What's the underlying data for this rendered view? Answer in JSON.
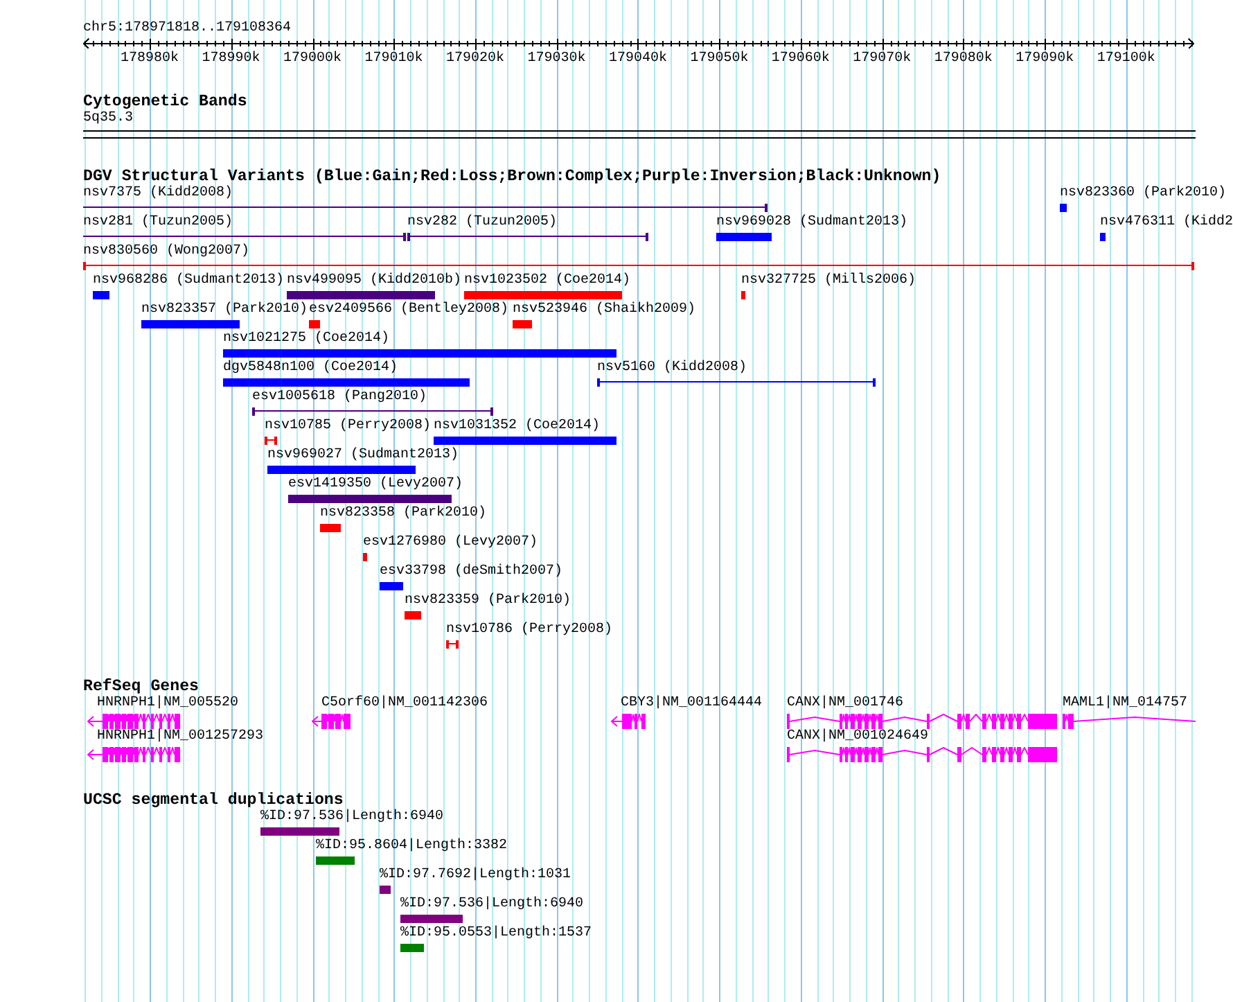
{
  "ruler": {
    "location": "chr5:178971818..179108364",
    "ticks": [
      "178980k",
      "178990k",
      "179000k",
      "179010k",
      "179020k",
      "179030k",
      "179040k",
      "179050k",
      "179060k",
      "179070k",
      "179080k",
      "179090k",
      "179100k"
    ]
  },
  "cytogenetic_bands": {
    "title": "Cytogenetic Bands",
    "band": "5q35.3"
  },
  "dgv_structural_variants": {
    "title": "DGV Structural Variants (Blue:Gain;Red:Loss;Brown:Complex;Purple:Inversion;Black:Unknown)",
    "rows": [
      {
        "features": [
          {
            "label": "nsv7375 (Kidd2008)",
            "kind": "span",
            "color": "#4b0082"
          },
          {
            "label": "nsv823360 (Park2010)",
            "kind": "bar",
            "color": "#0000ff"
          }
        ]
      },
      {
        "features": [
          {
            "label": "nsv281 (Tuzun2005)",
            "kind": "span",
            "color": "#4b0082"
          },
          {
            "label": "nsv282 (Tuzun2005)",
            "kind": "span",
            "color": "#4b0082"
          },
          {
            "label": "nsv969028 (Sudmant2013)",
            "kind": "bar",
            "color": "#0000ff"
          },
          {
            "label": "nsv476311 (Kidd2",
            "kind": "bar",
            "color": "#0000ff"
          }
        ]
      },
      {
        "features": [
          {
            "label": "nsv830560 (Wong2007)",
            "kind": "span",
            "color": "#ff0000"
          }
        ]
      },
      {
        "features": [
          {
            "label": "nsv968286 (Sudmant2013)",
            "kind": "bar",
            "color": "#0000ff"
          },
          {
            "label": "nsv499095 (Kidd2010b)",
            "kind": "bar",
            "color": "#4b0082"
          },
          {
            "label": "nsv1023502 (Coe2014)",
            "kind": "bar",
            "color": "#ff0000"
          },
          {
            "label": "nsv327725 (Mills2006)",
            "kind": "bar",
            "color": "#ff0000"
          }
        ]
      },
      {
        "features": [
          {
            "label": "nsv823357 (Park2010)",
            "kind": "bar",
            "color": "#0000ff"
          },
          {
            "label": "esv2409566 (Bentley2008)",
            "kind": "bar",
            "color": "#ff0000"
          },
          {
            "label": "nsv523946 (Shaikh2009)",
            "kind": "bar",
            "color": "#ff0000"
          }
        ]
      },
      {
        "features": [
          {
            "label": "nsv1021275 (Coe2014)",
            "kind": "bar",
            "color": "#0000ff"
          }
        ]
      },
      {
        "features": [
          {
            "label": "dgv5848n100 (Coe2014)",
            "kind": "bar",
            "color": "#0000ff"
          },
          {
            "label": "nsv5160 (Kidd2008)",
            "kind": "span",
            "color": "#0000ff"
          }
        ]
      },
      {
        "features": [
          {
            "label": "esv1005618 (Pang2010)",
            "kind": "span",
            "color": "#4b0082"
          }
        ]
      },
      {
        "features": [
          {
            "label": "nsv10785 (Perry2008)",
            "kind": "span",
            "color": "#ff0000"
          },
          {
            "label": "nsv1031352 (Coe2014)",
            "kind": "bar",
            "color": "#0000ff"
          }
        ]
      },
      {
        "features": [
          {
            "label": "nsv969027 (Sudmant2013)",
            "kind": "bar",
            "color": "#0000ff"
          }
        ]
      },
      {
        "features": [
          {
            "label": "esv1419350 (Levy2007)",
            "kind": "bar",
            "color": "#4b0082"
          }
        ]
      },
      {
        "features": [
          {
            "label": "nsv823358 (Park2010)",
            "kind": "bar",
            "color": "#ff0000"
          }
        ]
      },
      {
        "features": [
          {
            "label": "esv1276980 (Levy2007)",
            "kind": "bar",
            "color": "#ff0000"
          }
        ]
      },
      {
        "features": [
          {
            "label": "esv33798 (deSmith2007)",
            "kind": "bar",
            "color": "#0000ff"
          }
        ]
      },
      {
        "features": [
          {
            "label": "nsv823359 (Park2010)",
            "kind": "bar",
            "color": "#ff0000"
          }
        ]
      },
      {
        "features": [
          {
            "label": "nsv10786 (Perry2008)",
            "kind": "span",
            "color": "#ff0000"
          }
        ]
      }
    ]
  },
  "refseq_genes": {
    "title": "RefSeq Genes",
    "rows": [
      {
        "genes": [
          {
            "label": "HNRNPH1|NM_005520"
          },
          {
            "label": "C5orf60|NM_001142306"
          },
          {
            "label": "CBY3|NM_001164444"
          },
          {
            "label": "CANX|NM_001746"
          },
          {
            "label": "MAML1|NM_014757"
          }
        ]
      },
      {
        "genes": [
          {
            "label": "HNRNPH1|NM_001257293"
          },
          {
            "label": "CANX|NM_001024649"
          }
        ]
      }
    ]
  },
  "segmental_duplications": {
    "title": "UCSC segmental duplications",
    "features": [
      {
        "label": "%ID:97.536|Length:6940",
        "color": "#800080"
      },
      {
        "label": "%ID:95.8604|Length:3382",
        "color": "#008000"
      },
      {
        "label": "%ID:97.7692|Length:1031",
        "color": "#800080"
      },
      {
        "label": "%ID:97.536|Length:6940",
        "color": "#800080"
      },
      {
        "label": "%ID:95.0553|Length:1537",
        "color": "#008000"
      }
    ]
  }
}
